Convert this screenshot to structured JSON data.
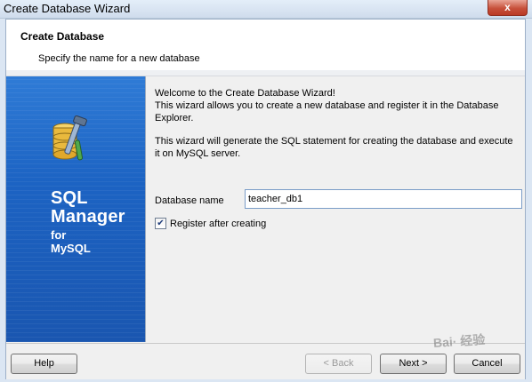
{
  "window": {
    "title": "Create Database Wizard",
    "close_label": "x"
  },
  "header": {
    "title": "Create Database",
    "subtitle": "Specify the name for a new database"
  },
  "brand": {
    "line1": "SQL",
    "line2": "Manager",
    "line3": "for",
    "line4": "MySQL",
    "logo_icon": "database-tools-icon"
  },
  "intro": {
    "p1": "Welcome to the Create Database Wizard!\nThis wizard allows you to create a new database and register it in the Database Explorer.",
    "p2": "This wizard will generate the SQL statement for creating the database and execute it on MySQL server."
  },
  "form": {
    "db_name_label": "Database name",
    "db_name_value": "teacher_db1",
    "register_label": "Register after creating",
    "register_checked": true
  },
  "buttons": {
    "help": "Help",
    "back": "< Back",
    "next": "Next >",
    "cancel": "Cancel"
  },
  "watermark": "Bai· 经验"
}
